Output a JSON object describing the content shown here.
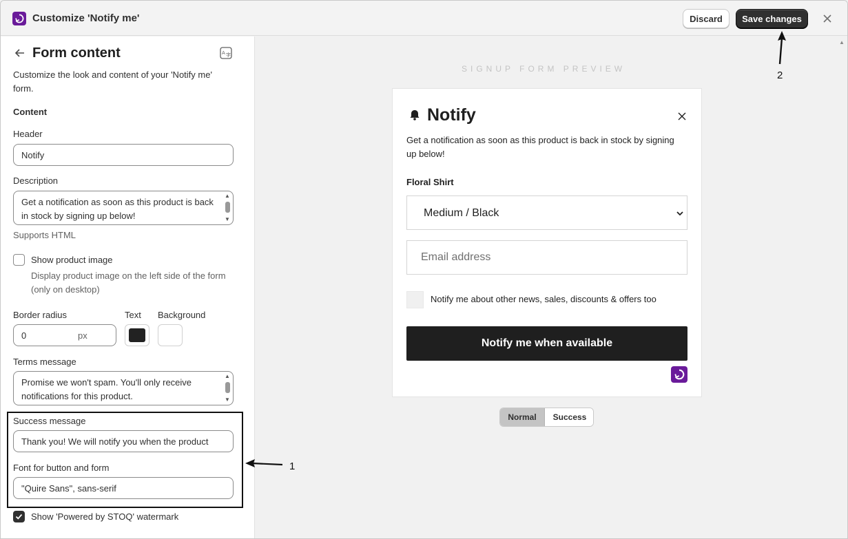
{
  "window": {
    "title": "Customize 'Notify me'",
    "discard_label": "Discard",
    "save_label": "Save changes",
    "accent_color": "#6a1b9a"
  },
  "panel": {
    "title": "Form content",
    "description": "Customize the look and content of your 'Notify me' form.",
    "section_heading": "Content",
    "header": {
      "label": "Header",
      "value": "Notify"
    },
    "description_field": {
      "label": "Description",
      "value": "Get a notification as soon as this product is back in stock by signing up below!",
      "help": "Supports HTML"
    },
    "show_product_image": {
      "label": "Show product image",
      "help": "Display product image on the left side of the form (only on desktop)",
      "checked": false
    },
    "border_radius": {
      "label": "Border radius",
      "value": "0",
      "unit": "px"
    },
    "text_color": {
      "label": "Text",
      "color": "#222222"
    },
    "background_color": {
      "label": "Background",
      "color": "#ffffff"
    },
    "terms_message": {
      "label": "Terms message",
      "value": "Promise we won't spam. You'll only receive notifications for this product."
    },
    "success_message": {
      "label": "Success message",
      "value": "Thank you! We will notify you when the product"
    },
    "font": {
      "label": "Font for button and form",
      "value": "\"Quire Sans\", sans-serif"
    },
    "watermark": {
      "label": "Show 'Powered by STOQ' watermark",
      "checked": true
    }
  },
  "preview": {
    "heading": "SIGNUP FORM PREVIEW",
    "form": {
      "title": "Notify",
      "description": "Get a notification as soon as this product is back in stock by signing up below!",
      "product_name": "Floral Shirt",
      "variant": "Medium / Black",
      "email_placeholder": "Email address",
      "marketing_label": "Notify me about other news, sales, discounts & offers too",
      "button_label": "Notify me when available"
    },
    "toggle": {
      "normal": "Normal",
      "success": "Success",
      "selected": "Normal"
    }
  },
  "annotations": {
    "one": "1",
    "two": "2"
  }
}
